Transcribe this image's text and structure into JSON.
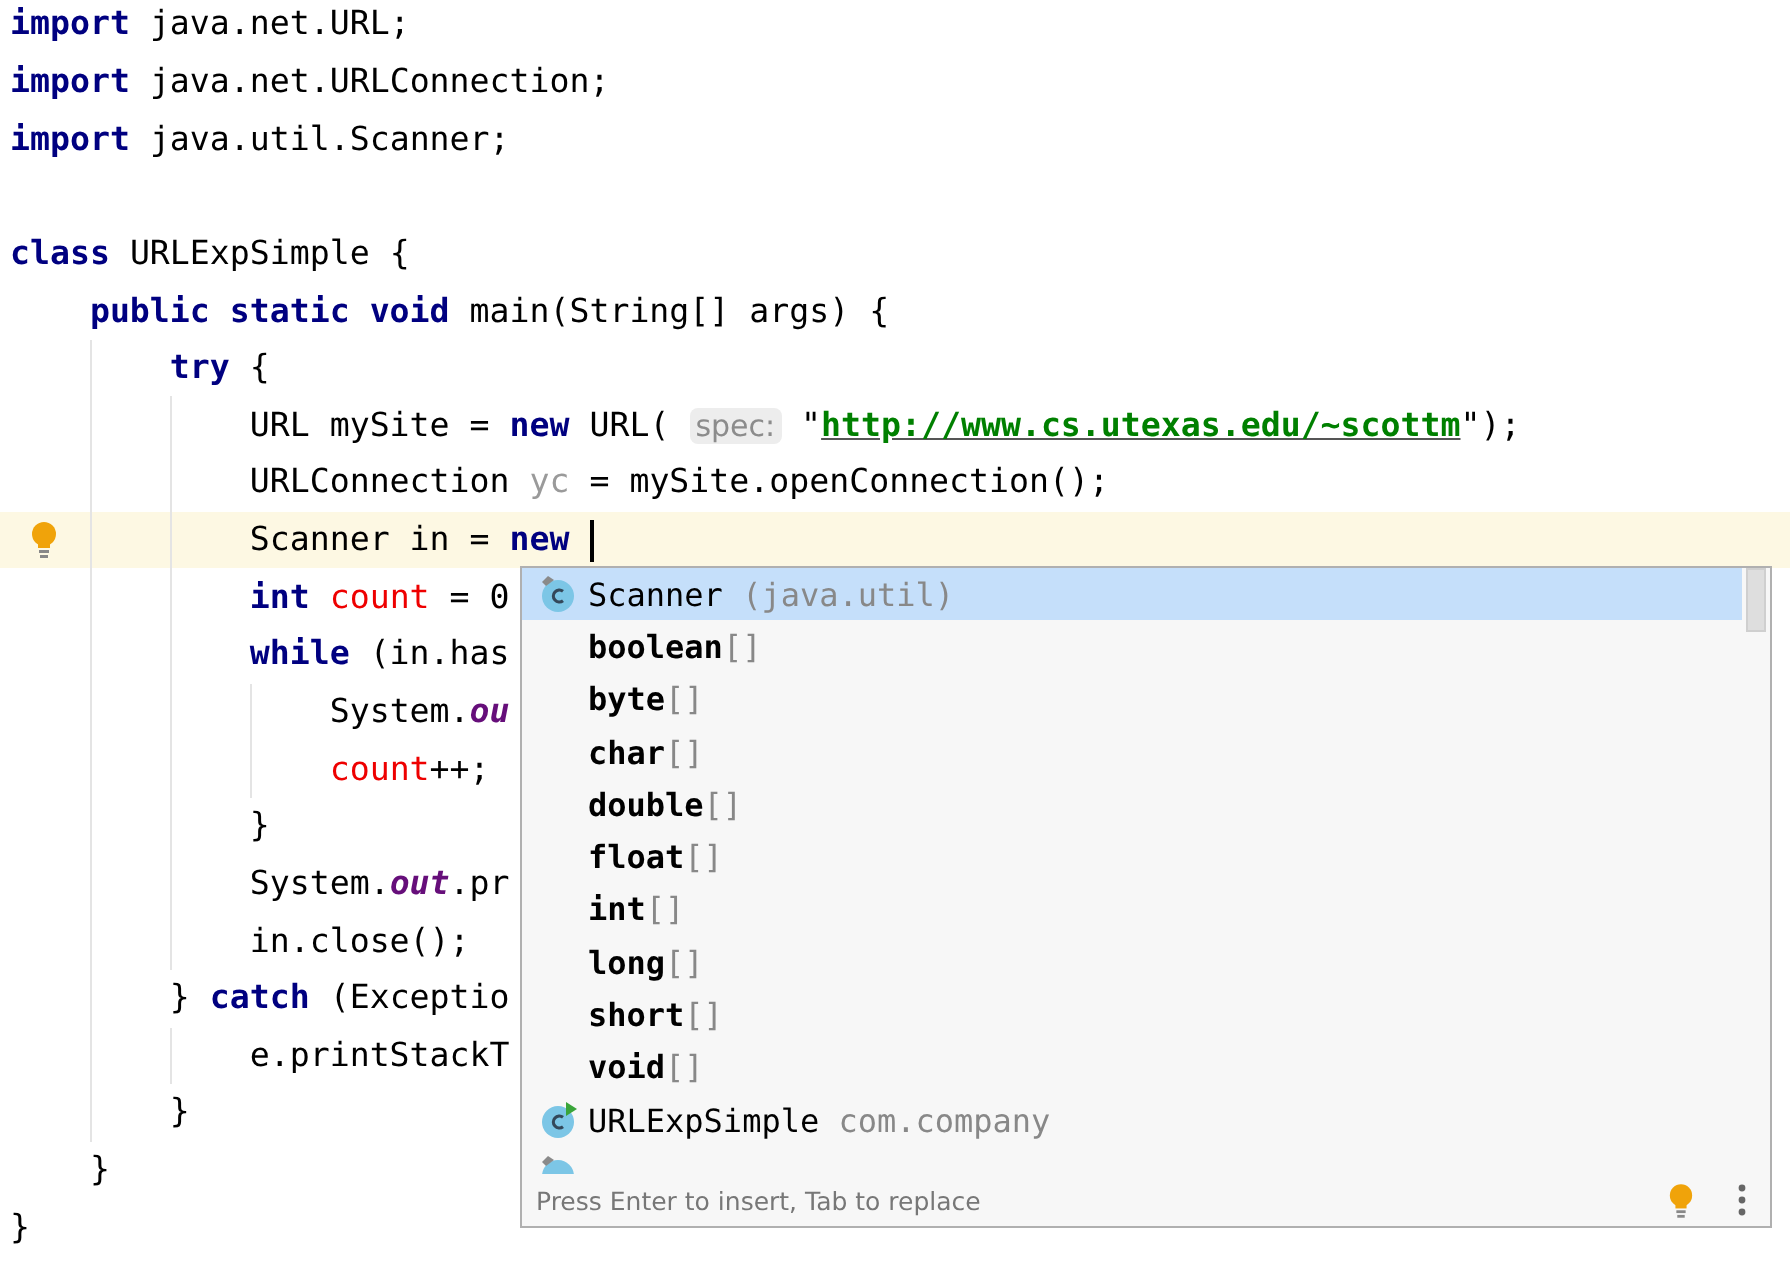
{
  "editor": {
    "lines": [
      {
        "current": false,
        "tokens": [
          {
            "kind": "kw",
            "text": "import"
          },
          {
            "kind": "plain",
            "text": " java.net.URL;"
          }
        ]
      },
      {
        "current": false,
        "tokens": [
          {
            "kind": "kw",
            "text": "import"
          },
          {
            "kind": "plain",
            "text": " java.net.URLConnection;"
          }
        ]
      },
      {
        "current": false,
        "tokens": [
          {
            "kind": "kw",
            "text": "import"
          },
          {
            "kind": "plain",
            "text": " java.util.Scanner;"
          }
        ]
      },
      {
        "current": false
      },
      {
        "current": false,
        "tokens": [
          {
            "kind": "kw",
            "text": "class"
          },
          {
            "kind": "plain",
            "text": " URLExpSimple {"
          }
        ]
      },
      {
        "current": false,
        "tokens": [
          {
            "kind": "kw",
            "text": "    public static void"
          },
          {
            "kind": "plain",
            "text": " main(String[] args) {"
          }
        ]
      },
      {
        "current": false,
        "tokens": [
          {
            "kind": "kw",
            "text": "        try"
          },
          {
            "kind": "plain",
            "text": " {"
          }
        ]
      },
      {
        "current": false,
        "tokens": [
          {
            "kind": "plain",
            "text": "            URL mySite = "
          },
          {
            "kind": "kw",
            "text": "new"
          },
          {
            "kind": "plain",
            "text": " URL( "
          },
          {
            "kind": "hint",
            "text": "spec:"
          },
          {
            "kind": "plain",
            "text": " \""
          },
          {
            "kind": "link",
            "text": "http://www.cs.utexas.edu/~scottm"
          },
          {
            "kind": "plain",
            "text": "\");"
          }
        ]
      },
      {
        "current": false,
        "tokens": [
          {
            "kind": "plain",
            "text": "            URLConnection "
          },
          {
            "kind": "unused",
            "text": "yc"
          },
          {
            "kind": "plain",
            "text": " = mySite.openConnection();"
          }
        ]
      },
      {
        "current": true,
        "tokens": [
          {
            "kind": "plain",
            "text": "            Scanner in = "
          },
          {
            "kind": "kw",
            "text": "new"
          }
        ]
      },
      {
        "current": false,
        "tokens": [
          {
            "kind": "kw",
            "text": "            int"
          },
          {
            "kind": "var",
            "text": " count"
          },
          {
            "kind": "plain",
            "text": " = 0"
          }
        ]
      },
      {
        "current": false,
        "tokens": [
          {
            "kind": "kw",
            "text": "            while"
          },
          {
            "kind": "plain",
            "text": " (in.has"
          }
        ]
      },
      {
        "current": false,
        "tokens": [
          {
            "kind": "plain",
            "text": "                System."
          },
          {
            "kind": "field",
            "text": "ou"
          }
        ]
      },
      {
        "current": false,
        "tokens": [
          {
            "kind": "var",
            "text": "                count"
          },
          {
            "kind": "plain",
            "text": "++;"
          }
        ]
      },
      {
        "current": false,
        "tokens": [
          {
            "kind": "plain",
            "text": "            }"
          }
        ]
      },
      {
        "current": false,
        "tokens": [
          {
            "kind": "plain",
            "text": "            System."
          },
          {
            "kind": "field",
            "text": "out"
          },
          {
            "kind": "plain",
            "text": ".pr"
          }
        ]
      },
      {
        "current": false,
        "tokens": [
          {
            "kind": "plain",
            "text": "            in.close();"
          }
        ]
      },
      {
        "current": false,
        "tokens": [
          {
            "kind": "plain",
            "text": "        } "
          },
          {
            "kind": "kw",
            "text": "catch"
          },
          {
            "kind": "plain",
            "text": " (Exceptio"
          }
        ]
      },
      {
        "current": false,
        "tokens": [
          {
            "kind": "plain",
            "text": "            e.printStackT"
          }
        ]
      },
      {
        "current": false,
        "tokens": [
          {
            "kind": "plain",
            "text": "        }"
          }
        ]
      },
      {
        "current": false,
        "tokens": [
          {
            "kind": "plain",
            "text": "    }"
          }
        ]
      },
      {
        "current": false,
        "tokens": [
          {
            "kind": "plain",
            "text": "}"
          }
        ]
      }
    ]
  },
  "completion": {
    "items": [
      {
        "kind": "class",
        "runnable": false,
        "selected": true,
        "name": "Scanner",
        "detail": "(java.util)"
      },
      {
        "kind": "primitive",
        "selected": false,
        "name": "boolean",
        "suffix": "[]"
      },
      {
        "kind": "primitive",
        "selected": false,
        "name": "byte",
        "suffix": "[]"
      },
      {
        "kind": "primitive",
        "selected": false,
        "name": "char",
        "suffix": "[]"
      },
      {
        "kind": "primitive",
        "selected": false,
        "name": "double",
        "suffix": "[]"
      },
      {
        "kind": "primitive",
        "selected": false,
        "name": "float",
        "suffix": "[]"
      },
      {
        "kind": "primitive",
        "selected": false,
        "name": "int",
        "suffix": "[]"
      },
      {
        "kind": "primitive",
        "selected": false,
        "name": "long",
        "suffix": "[]"
      },
      {
        "kind": "primitive",
        "selected": false,
        "name": "short",
        "suffix": "[]"
      },
      {
        "kind": "primitive",
        "selected": false,
        "name": "void",
        "suffix": "[]"
      },
      {
        "kind": "class",
        "runnable": true,
        "selected": false,
        "name": "URLExpSimple",
        "detail": "com.company"
      }
    ],
    "footer": "Press Enter to insert, Tab to replace"
  }
}
